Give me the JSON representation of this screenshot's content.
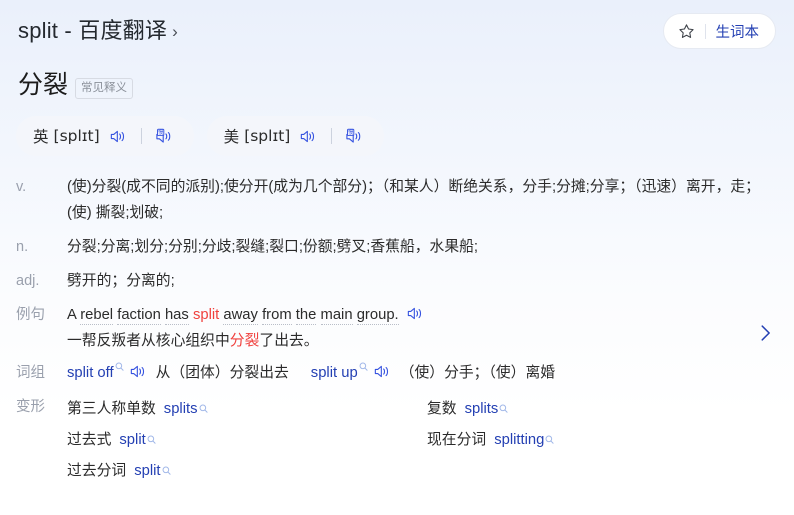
{
  "header": {
    "title": "split - 百度翻译",
    "chevron": "›",
    "vocab_button": {
      "icon": "star-icon",
      "label": "生词本"
    }
  },
  "headword": {
    "word": "分裂",
    "badge": "常见释义"
  },
  "phonetics": [
    {
      "lang": "英",
      "ipa": "[splɪt]",
      "speaker_icon": "speaker-icon",
      "slow_speaker_icon": "slow-speaker-icon",
      "slow_glyph": "慢"
    },
    {
      "lang": "美",
      "ipa": "[splɪt]",
      "speaker_icon": "speaker-icon",
      "slow_speaker_icon": "slow-speaker-icon",
      "slow_glyph": "慢"
    }
  ],
  "definitions": [
    {
      "pos": "v.",
      "text": "(使)分裂(成不同的派别);使分开(成为几个部分)；（和某人）断绝关系，分手;分摊;分享；（迅速）离开，走；(使) 撕裂;划破;"
    },
    {
      "pos": "n.",
      "text": "分裂;分离;划分;分别;分歧;裂缝;裂口;份额;劈叉;香蕉船，水果船;"
    },
    {
      "pos": "adj.",
      "text": "劈开的；分离的;"
    }
  ],
  "example": {
    "label": "例句",
    "en_parts": [
      {
        "text": "A",
        "highlight": false,
        "underline": false
      },
      {
        "text": "rebel",
        "highlight": false,
        "underline": true
      },
      {
        "text": "faction",
        "highlight": false,
        "underline": true
      },
      {
        "text": "has",
        "highlight": false,
        "underline": true
      },
      {
        "text": "split",
        "highlight": true,
        "underline": false
      },
      {
        "text": "away",
        "highlight": false,
        "underline": true
      },
      {
        "text": "from",
        "highlight": false,
        "underline": true
      },
      {
        "text": "the",
        "highlight": false,
        "underline": true
      },
      {
        "text": "main",
        "highlight": false,
        "underline": true
      },
      {
        "text": "group.",
        "highlight": false,
        "underline": true
      }
    ],
    "en_plain": "A rebel faction has split away from the main group.",
    "speaker_icon": "speaker-icon",
    "cn_before": "一帮反叛者从核心组织中",
    "cn_highlight": "分裂",
    "cn_after": "了出去。"
  },
  "phrases": {
    "label": "词组",
    "items": [
      {
        "term": "split off",
        "search_icon": "search-icon",
        "speaker_icon": "speaker-icon",
        "meaning": "从（团体）分裂出去"
      },
      {
        "term": "split up",
        "search_icon": "search-icon",
        "speaker_icon": "speaker-icon",
        "meaning": "（使）分手；（使）离婚"
      }
    ]
  },
  "inflections": {
    "label": "变形",
    "rows": [
      [
        {
          "name": "第三人称单数",
          "value": "splits",
          "search_icon": "search-icon"
        },
        {
          "name": "复数",
          "value": "splits",
          "search_icon": "search-icon"
        }
      ],
      [
        {
          "name": "过去式",
          "value": "split",
          "search_icon": "search-icon"
        },
        {
          "name": "现在分词",
          "value": "splitting",
          "search_icon": "search-icon"
        }
      ],
      [
        {
          "name": "过去分词",
          "value": "split",
          "search_icon": "search-icon"
        }
      ]
    ]
  },
  "expand": {
    "icon": "chevron-right-icon"
  },
  "colors": {
    "link": "#2440b3",
    "highlight": "#f0413e",
    "label_gray": "#9aa0ad",
    "pill_bg": "#f4f6fb",
    "page_gradient_top": "#eaf0fb"
  }
}
